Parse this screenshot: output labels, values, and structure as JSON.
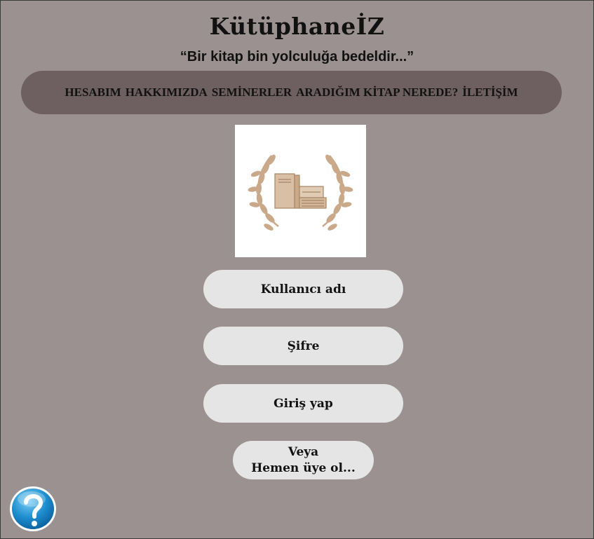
{
  "header": {
    "site_title": "KütüphaneİZ",
    "slogan": "“Bir kitap bin yolculuğa bedeldir...”"
  },
  "nav": {
    "items": [
      {
        "label": "HESABIM"
      },
      {
        "label": "HAKKIMIZDA"
      },
      {
        "label": "SEMİNERLER"
      },
      {
        "label": "ARADIĞIM KİTAP NEREDE?"
      },
      {
        "label": "İLETİŞİM"
      }
    ]
  },
  "logo": {
    "icon": "books-laurel-icon"
  },
  "login": {
    "username_placeholder": "Kullanıcı adı",
    "password_placeholder": "Şifre",
    "submit_label": "Giriş yap",
    "register_line1": "Veya",
    "register_line2": "Hemen üye ol..."
  },
  "help": {
    "icon": "question-mark-icon"
  },
  "colors": {
    "background": "#9b9190",
    "navbar": "#6e5f61",
    "pill": "#e6e5e5",
    "logo_accent": "#c9a98a"
  }
}
